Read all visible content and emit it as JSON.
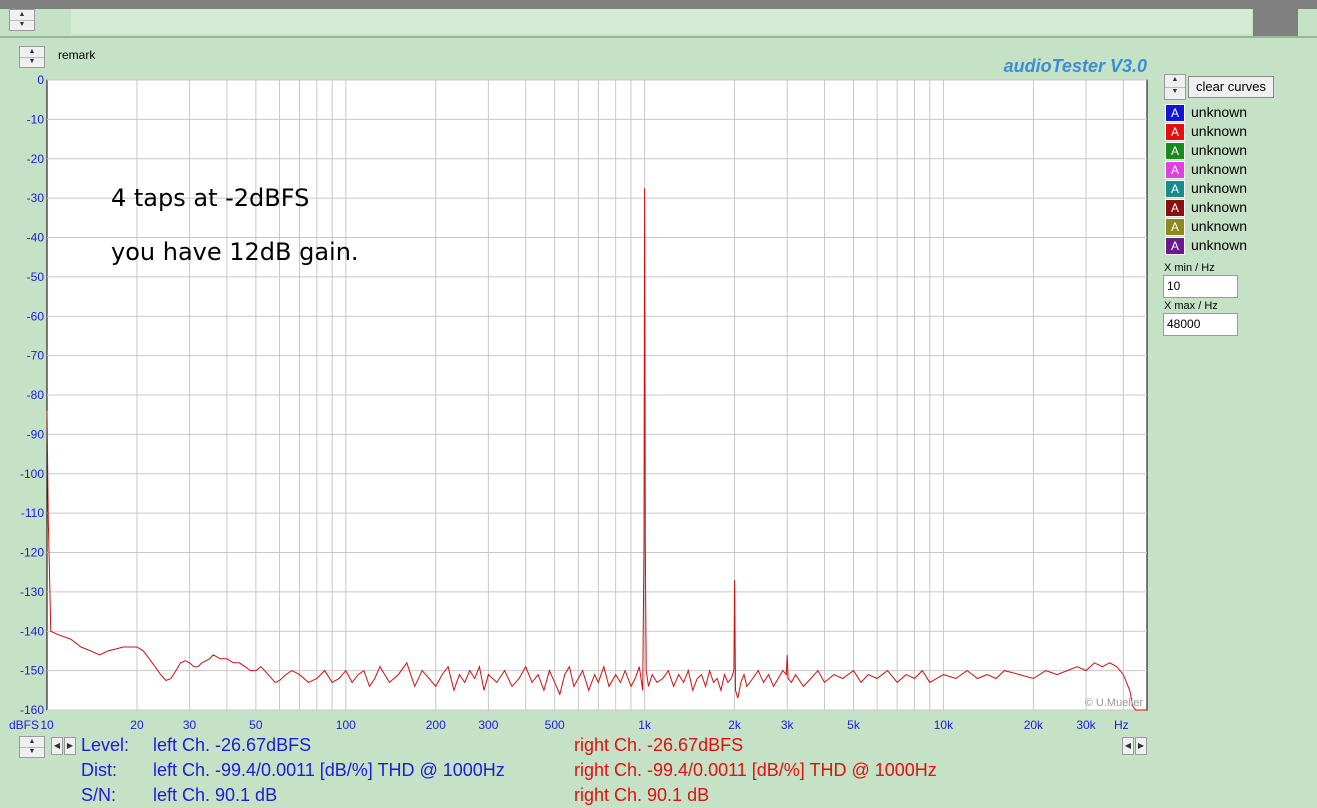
{
  "app": {
    "brand": "audioTester  V3.0",
    "remark_label": "remark",
    "clear_button": "clear curves"
  },
  "legend": [
    {
      "letter": "A",
      "color": "#1414d8",
      "label": "unknown"
    },
    {
      "letter": "A",
      "color": "#e01010",
      "label": "unknown"
    },
    {
      "letter": "A",
      "color": "#1a8a1a",
      "label": "unknown"
    },
    {
      "letter": "A",
      "color": "#e040e0",
      "label": "unknown"
    },
    {
      "letter": "A",
      "color": "#1a8a8a",
      "label": "unknown"
    },
    {
      "letter": "A",
      "color": "#8a1010",
      "label": "unknown"
    },
    {
      "letter": "A",
      "color": "#8a8a20",
      "label": "unknown"
    },
    {
      "letter": "A",
      "color": "#6a1a8a",
      "label": "unknown"
    }
  ],
  "range": {
    "xmin_label": "X min / Hz",
    "xmin_value": "10",
    "xmax_label": "X max / Hz",
    "xmax_value": "48000"
  },
  "annotations": [
    "4 taps at -2dBFS",
    "you have 12dB gain."
  ],
  "readouts": {
    "level_label": "Level:",
    "dist_label": "Dist:",
    "sn_label": "S/N:",
    "left_level": "left Ch. -26.67dBFS",
    "left_dist": "left Ch. -99.4/0.0011 [dB/%] THD @ 1000Hz",
    "left_sn": "left Ch. 90.1 dB",
    "right_level": "right Ch. -26.67dBFS",
    "right_dist": "right Ch. -99.4/0.0011 [dB/%] THD @ 1000Hz",
    "right_sn": "right Ch. 90.1 dB"
  },
  "chart_data": {
    "type": "line",
    "xscale": "log",
    "xlim": [
      10,
      48000
    ],
    "ylim": [
      -160,
      0
    ],
    "grid": true,
    "ylabel": "dBFS",
    "xunit": "Hz",
    "watermark": "© U.Mueller",
    "yticks": [
      0,
      -10,
      -20,
      -30,
      -40,
      -50,
      -60,
      -70,
      -80,
      -90,
      -100,
      -110,
      -120,
      -130,
      -140,
      -150,
      -160
    ],
    "xticks": [
      {
        "v": 10,
        "l": "10"
      },
      {
        "v": 20,
        "l": "20"
      },
      {
        "v": 30,
        "l": "30"
      },
      {
        "v": 50,
        "l": "50"
      },
      {
        "v": 100,
        "l": "100"
      },
      {
        "v": 200,
        "l": "200"
      },
      {
        "v": 300,
        "l": "300"
      },
      {
        "v": 500,
        "l": "500"
      },
      {
        "v": 1000,
        "l": "1k"
      },
      {
        "v": 2000,
        "l": "2k"
      },
      {
        "v": 3000,
        "l": "3k"
      },
      {
        "v": 5000,
        "l": "5k"
      },
      {
        "v": 10000,
        "l": "10k"
      },
      {
        "v": 20000,
        "l": "20k"
      },
      {
        "v": 30000,
        "l": "30k"
      }
    ],
    "series": [
      {
        "color": "#cc1010",
        "points": [
          [
            10,
            -84
          ],
          [
            10.1,
            -112
          ],
          [
            10.3,
            -140
          ],
          [
            11,
            -141
          ],
          [
            12,
            -142
          ],
          [
            13,
            -144
          ],
          [
            14,
            -145
          ],
          [
            15,
            -146
          ],
          [
            16,
            -145
          ],
          [
            17,
            -144.5
          ],
          [
            18,
            -144
          ],
          [
            19,
            -144
          ],
          [
            20,
            -144
          ],
          [
            21,
            -145
          ],
          [
            22,
            -147
          ],
          [
            23,
            -149
          ],
          [
            24,
            -151
          ],
          [
            25,
            -152.5
          ],
          [
            26,
            -152
          ],
          [
            27,
            -150
          ],
          [
            28,
            -148
          ],
          [
            29,
            -147.5
          ],
          [
            30,
            -148
          ],
          [
            31,
            -149
          ],
          [
            32,
            -149
          ],
          [
            33,
            -148
          ],
          [
            34,
            -147.5
          ],
          [
            35,
            -147
          ],
          [
            36,
            -146
          ],
          [
            37,
            -146.5
          ],
          [
            38,
            -147
          ],
          [
            40,
            -147
          ],
          [
            42,
            -148
          ],
          [
            44,
            -148
          ],
          [
            46,
            -149
          ],
          [
            48,
            -150
          ],
          [
            50,
            -150
          ],
          [
            52,
            -149
          ],
          [
            55,
            -151
          ],
          [
            58,
            -153
          ],
          [
            60,
            -152.5
          ],
          [
            63,
            -151
          ],
          [
            66,
            -150
          ],
          [
            70,
            -151
          ],
          [
            75,
            -153
          ],
          [
            80,
            -152
          ],
          [
            85,
            -150
          ],
          [
            90,
            -153
          ],
          [
            95,
            -152
          ],
          [
            100,
            -150
          ],
          [
            105,
            -153
          ],
          [
            110,
            -151
          ],
          [
            115,
            -150
          ],
          [
            120,
            -154
          ],
          [
            125,
            -152
          ],
          [
            130,
            -149
          ],
          [
            140,
            -153
          ],
          [
            150,
            -151
          ],
          [
            160,
            -148
          ],
          [
            170,
            -154
          ],
          [
            180,
            -150
          ],
          [
            190,
            -152
          ],
          [
            200,
            -154
          ],
          [
            210,
            -151
          ],
          [
            220,
            -149
          ],
          [
            230,
            -155
          ],
          [
            240,
            -151
          ],
          [
            250,
            -153
          ],
          [
            260,
            -150
          ],
          [
            270,
            -152
          ],
          [
            280,
            -149
          ],
          [
            290,
            -155
          ],
          [
            300,
            -151
          ],
          [
            320,
            -153
          ],
          [
            340,
            -150
          ],
          [
            360,
            -154
          ],
          [
            380,
            -152
          ],
          [
            400,
            -149
          ],
          [
            420,
            -153
          ],
          [
            440,
            -151
          ],
          [
            460,
            -155
          ],
          [
            480,
            -150
          ],
          [
            500,
            -153
          ],
          [
            520,
            -156
          ],
          [
            540,
            -151
          ],
          [
            560,
            -149
          ],
          [
            580,
            -154
          ],
          [
            600,
            -152
          ],
          [
            620,
            -150
          ],
          [
            650,
            -155
          ],
          [
            680,
            -151
          ],
          [
            700,
            -153
          ],
          [
            730,
            -149
          ],
          [
            760,
            -154
          ],
          [
            800,
            -151
          ],
          [
            830,
            -153
          ],
          [
            860,
            -150
          ],
          [
            900,
            -154
          ],
          [
            930,
            -152
          ],
          [
            960,
            -149
          ],
          [
            985,
            -155
          ],
          [
            995,
            -118
          ],
          [
            1000,
            -27.5
          ],
          [
            1002,
            -58
          ],
          [
            1005,
            -118
          ],
          [
            1012,
            -150
          ],
          [
            1030,
            -154
          ],
          [
            1060,
            -151
          ],
          [
            1100,
            -153
          ],
          [
            1150,
            -152
          ],
          [
            1200,
            -150
          ],
          [
            1250,
            -154
          ],
          [
            1300,
            -151
          ],
          [
            1350,
            -153
          ],
          [
            1400,
            -150
          ],
          [
            1450,
            -155
          ],
          [
            1500,
            -152
          ],
          [
            1550,
            -151
          ],
          [
            1600,
            -154
          ],
          [
            1650,
            -150
          ],
          [
            1700,
            -153
          ],
          [
            1750,
            -152
          ],
          [
            1800,
            -155
          ],
          [
            1850,
            -151
          ],
          [
            1900,
            -153
          ],
          [
            1950,
            -152
          ],
          [
            1990,
            -150
          ],
          [
            2000,
            -127
          ],
          [
            2005,
            -137
          ],
          [
            2015,
            -155
          ],
          [
            2050,
            -157
          ],
          [
            2100,
            -153
          ],
          [
            2150,
            -151
          ],
          [
            2200,
            -154
          ],
          [
            2300,
            -152
          ],
          [
            2400,
            -150
          ],
          [
            2500,
            -153
          ],
          [
            2600,
            -151
          ],
          [
            2700,
            -154
          ],
          [
            2800,
            -152
          ],
          [
            2900,
            -150
          ],
          [
            2980,
            -151
          ],
          [
            3000,
            -146
          ],
          [
            3020,
            -152
          ],
          [
            3100,
            -153
          ],
          [
            3200,
            -151
          ],
          [
            3400,
            -154
          ],
          [
            3600,
            -152
          ],
          [
            3800,
            -150
          ],
          [
            4000,
            -153
          ],
          [
            4300,
            -151
          ],
          [
            4600,
            -152
          ],
          [
            5000,
            -150
          ],
          [
            5300,
            -153
          ],
          [
            5600,
            -151
          ],
          [
            6000,
            -152
          ],
          [
            6500,
            -150
          ],
          [
            7000,
            -153
          ],
          [
            7500,
            -151
          ],
          [
            8000,
            -152
          ],
          [
            8500,
            -150
          ],
          [
            9000,
            -153
          ],
          [
            10000,
            -151
          ],
          [
            11000,
            -152
          ],
          [
            12000,
            -150
          ],
          [
            13000,
            -152
          ],
          [
            14000,
            -151
          ],
          [
            15000,
            -152
          ],
          [
            16000,
            -150
          ],
          [
            18000,
            -151
          ],
          [
            20000,
            -152
          ],
          [
            22000,
            -150
          ],
          [
            24000,
            -151
          ],
          [
            26000,
            -150
          ],
          [
            28000,
            -149
          ],
          [
            30000,
            -150
          ],
          [
            32000,
            -148
          ],
          [
            34000,
            -149
          ],
          [
            36000,
            -148
          ],
          [
            38000,
            -149
          ],
          [
            40000,
            -151
          ],
          [
            42000,
            -155
          ],
          [
            43000,
            -159
          ],
          [
            44000,
            -160
          ],
          [
            48000,
            -160
          ]
        ]
      }
    ]
  }
}
